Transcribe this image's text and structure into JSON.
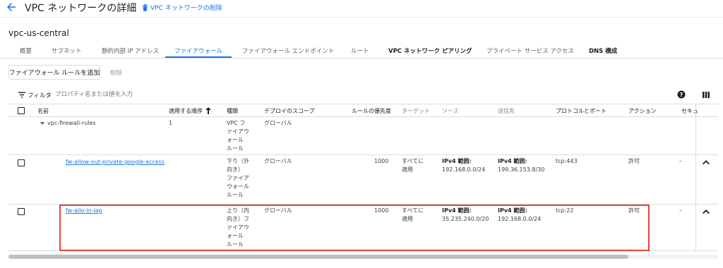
{
  "header": {
    "title": "VPC ネットワークの詳細",
    "delete_label": "VPC ネットワークの削除"
  },
  "vpc_name": "vpc-us-central",
  "tabs": [
    {
      "label": "概要"
    },
    {
      "label": "サブネット"
    },
    {
      "label": "静的内部 IP アドレス"
    },
    {
      "label": "ファイアウォール",
      "active": true
    },
    {
      "label": "ファイアウォール エンドポイント"
    },
    {
      "label": "ルート"
    },
    {
      "label": "VPC ネットワーク ピアリング"
    },
    {
      "label": "プライベート サービス アクセス"
    },
    {
      "label": "DNS 構成"
    }
  ],
  "toolbar": {
    "add_rule_label": "ファイアウォール ルールを追加",
    "delete_label": "削除"
  },
  "filter": {
    "label": "フィルタ",
    "placeholder": "プロパティ名または値を入力"
  },
  "table": {
    "columns": [
      "名前",
      "適用する順序",
      "種類",
      "デプロイのスコープ",
      "ルールの優先度",
      "ターゲット",
      "ソース",
      "送信先",
      "プロトコルとポート",
      "アクション",
      "セキュ"
    ],
    "group": {
      "name": "vpc-firewall-rules",
      "order": "1",
      "type_lines": [
        "VPC フ",
        "ァイアウ",
        "ォール",
        "ルール"
      ],
      "scope": "グローバル"
    },
    "rows": [
      {
        "name": "fw-allow-out-private-google-access",
        "type_lines": [
          "下り（外",
          "向き）",
          "ファイア",
          "ウォール",
          "ルール"
        ],
        "scope": "グローバル",
        "priority": "1000",
        "target_lines": [
          "すべてに",
          "適用"
        ],
        "source_label": "IPv4 範囲:",
        "source_value": "192.168.0.0/24",
        "dest_label": "IPv4 範囲:",
        "dest_value": "199.36.153.8/30",
        "protocol": "tcp:443",
        "action": "許可",
        "security": "–"
      },
      {
        "name": "fw-allo-in-iap",
        "type_lines": [
          "上り（内",
          "向き）フ",
          "ァイアウ",
          "ォール",
          "ルール"
        ],
        "scope": "グローバル",
        "priority": "1000",
        "target_lines": [
          "すべてに",
          "適用"
        ],
        "source_label": "IPv4 範囲:",
        "source_value": "35.235.240.0/20",
        "dest_label": "IPv4 範囲:",
        "dest_value": "192.168.0.0/24",
        "protocol": "tcp:22",
        "action": "許可",
        "security": "–"
      }
    ]
  },
  "colors": {
    "accent": "#1a73e8",
    "highlight": "#ea4335",
    "border": "#dadce0"
  }
}
